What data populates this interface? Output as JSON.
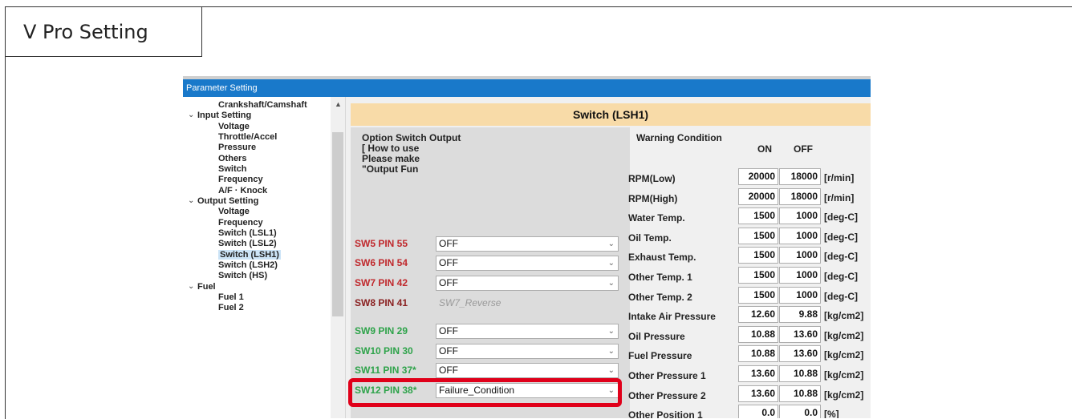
{
  "page": {
    "title": "V Pro Setting"
  },
  "window": {
    "title": "Parameter Setting"
  },
  "tree": {
    "items": [
      {
        "label": "Crankshaft/Camshaft",
        "level": 1
      },
      {
        "label": "Input Setting",
        "level": 0,
        "expanded": true
      },
      {
        "label": "Voltage",
        "level": 1
      },
      {
        "label": "Throttle/Accel",
        "level": 1
      },
      {
        "label": "Pressure",
        "level": 1
      },
      {
        "label": "Others",
        "level": 1
      },
      {
        "label": "Switch",
        "level": 1
      },
      {
        "label": "Frequency",
        "level": 1
      },
      {
        "label": "A/F · Knock",
        "level": 1
      },
      {
        "label": "Output Setting",
        "level": 0,
        "expanded": true
      },
      {
        "label": "Voltage",
        "level": 1
      },
      {
        "label": "Frequency",
        "level": 1
      },
      {
        "label": "Switch (LSL1)",
        "level": 1
      },
      {
        "label": "Switch (LSL2)",
        "level": 1
      },
      {
        "label": "Switch (LSH1)",
        "level": 1,
        "selected": true
      },
      {
        "label": "Switch (LSH2)",
        "level": 1
      },
      {
        "label": "Switch (HS)",
        "level": 1
      },
      {
        "label": "Fuel",
        "level": 0,
        "expanded": true
      },
      {
        "label": "Fuel 1",
        "level": 1
      },
      {
        "label": "Fuel 2",
        "level": 1
      }
    ]
  },
  "panel": {
    "header": "Switch (LSH1)",
    "option_title": "Option Switch Output",
    "option_lines": [
      "[ How to use",
      "Please make",
      "\"Output Fun"
    ],
    "switches": [
      {
        "label": "SW5 PIN 55",
        "value": "OFF",
        "color": "red"
      },
      {
        "label": "SW6 PIN 54",
        "value": "OFF",
        "color": "red"
      },
      {
        "label": "SW7 PIN 42",
        "value": "OFF",
        "color": "red"
      },
      {
        "label": "SW8 PIN 41",
        "value": "SW7_Reverse",
        "color": "dark"
      },
      {
        "label": "SW9 PIN 29",
        "value": "OFF",
        "color": "green"
      },
      {
        "label": "SW10 PIN 30",
        "value": "OFF",
        "color": "green"
      },
      {
        "label": "SW11 PIN 37*",
        "value": "OFF",
        "color": "green"
      },
      {
        "label": "SW12 PIN 38*",
        "value": "Failure_Condition",
        "color": "green"
      }
    ],
    "warning": {
      "title": "Warning Condition",
      "col_on": "ON",
      "col_off": "OFF",
      "rows": [
        {
          "label": "RPM(Low)",
          "on": "20000",
          "off": "18000",
          "unit": "[r/min]"
        },
        {
          "label": "RPM(High)",
          "on": "20000",
          "off": "18000",
          "unit": "[r/min]"
        },
        {
          "label": "Water Temp.",
          "on": "1500",
          "off": "1000",
          "unit": "[deg-C]"
        },
        {
          "label": "Oil Temp.",
          "on": "1500",
          "off": "1000",
          "unit": "[deg-C]"
        },
        {
          "label": "Exhaust Temp.",
          "on": "1500",
          "off": "1000",
          "unit": "[deg-C]"
        },
        {
          "label": "Other Temp. 1",
          "on": "1500",
          "off": "1000",
          "unit": "[deg-C]"
        },
        {
          "label": "Other Temp. 2",
          "on": "1500",
          "off": "1000",
          "unit": "[deg-C]"
        },
        {
          "label": "Intake Air Pressure",
          "on": "12.60",
          "off": "9.88",
          "unit": "[kg/cm2]"
        },
        {
          "label": "Oil Pressure",
          "on": "10.88",
          "off": "13.60",
          "unit": "[kg/cm2]"
        },
        {
          "label": "Fuel Pressure",
          "on": "10.88",
          "off": "13.60",
          "unit": "[kg/cm2]"
        },
        {
          "label": "Other Pressure 1",
          "on": "13.60",
          "off": "10.88",
          "unit": "[kg/cm2]"
        },
        {
          "label": "Other Pressure 2",
          "on": "13.60",
          "off": "10.88",
          "unit": "[kg/cm2]"
        },
        {
          "label": "Other Position 1",
          "on": "0.0",
          "off": "0.0",
          "unit": "[%]"
        }
      ]
    }
  },
  "colors": {
    "header_bg": "#f8dba8",
    "titlebar": "#1979ca",
    "highlight": "#e0001a",
    "sw_red": "#c0282c",
    "sw_green": "#2ea34a"
  },
  "icons": {
    "expand": "chevron-down-icon",
    "scroll_up": "scroll-up-arrow-icon",
    "dropdown": "chevron-down-icon"
  }
}
